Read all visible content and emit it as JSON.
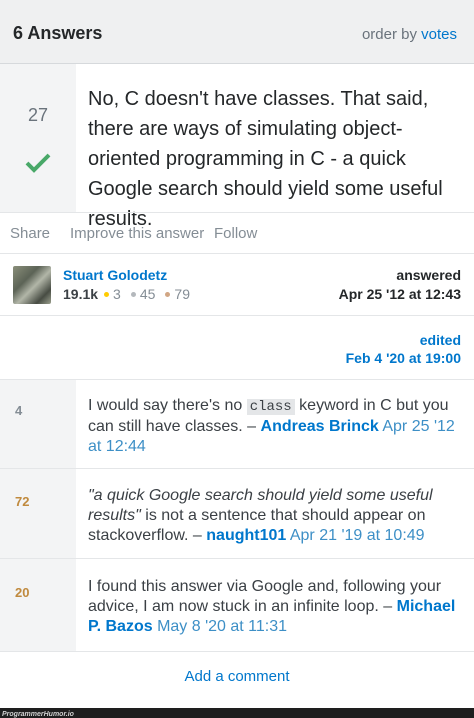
{
  "header": {
    "count": "6 Answers",
    "order_prefix": "order by",
    "order_value": "votes"
  },
  "answer": {
    "score": "27",
    "accepted": true,
    "body": "No, C doesn't have classes. That said, there are ways of simulating object-oriented programming in C - a quick Google search should yield some useful results."
  },
  "actions": {
    "share": "Share",
    "improve": "Improve this answer",
    "follow": "Follow"
  },
  "author": {
    "name": "Stuart Golodetz",
    "reputation": "19.1k",
    "gold": "3",
    "silver": "45",
    "bronze": "79",
    "answered_label": "answered",
    "answered_date": "Apr 25 '12 at 12:43"
  },
  "edited": {
    "label": "edited",
    "date": "Feb 4 '20 at 19:00"
  },
  "comments": [
    {
      "score": "4",
      "text_before": "I would say there's no",
      "code": "class",
      "text_after": "keyword in C but you can still have classes. –",
      "user": "Andreas Brinck",
      "date": "Apr 25 '12 at 12:44"
    },
    {
      "score": "72",
      "quote": "\"a quick Google search should yield some useful results\"",
      "text_after": "is not a sentence that should appear on stackoverflow. –",
      "user": "naught101",
      "date": "Apr 21 '19 at 10:49"
    },
    {
      "score": "20",
      "text_before": "I found this answer via Google and, following your advice, I am now stuck in an infinite loop. –",
      "user": "Michael P. Bazos",
      "date": "May 8 '20 at 11:31"
    }
  ],
  "add_comment": "Add a comment",
  "watermark": "ProgrammerHumor.io",
  "colors": {
    "link": "#0077cc",
    "accepted": "#48a868",
    "gold": "#ffcc01",
    "silver": "#b4b8bc",
    "bronze": "#d1a684",
    "score_high": "#c08a3e",
    "score_low": "#848d95"
  }
}
